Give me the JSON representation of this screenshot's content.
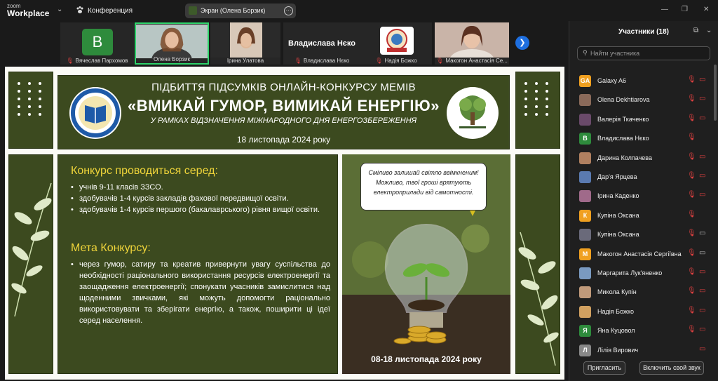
{
  "app": {
    "logo_top": "zoom",
    "logo_bottom": "Workplace",
    "meeting_label": "Конференция"
  },
  "share": {
    "label": "Экран (Олена Борзик)"
  },
  "videos": [
    {
      "name": "Вячеслав Пархомов",
      "initial": "В"
    },
    {
      "name": "Олена Борзик"
    },
    {
      "name": "Ірина Улатова"
    },
    {
      "name": "Владислава Нєко",
      "big_name": "Владислава Нєко"
    },
    {
      "name": "Надія Божко"
    },
    {
      "name": "Макогон Анастасія Се..."
    }
  ],
  "slide": {
    "title_line1": "ПІДБИТТЯ ПІДСУМКІВ ОНЛАЙН-КОНКУРСУ МЕМІВ",
    "title_line2": "«ВМИКАЙ ГУМОР, ВИМИКАЙ ЕНЕРГІЮ»",
    "subtitle": "У РАМКАХ ВІДЗНАЧЕННЯ МІЖНАРОДНОГО ДНЯ ЕНЕРГОЗБЕРЕЖЕННЯ",
    "date": "18 листопада 2024 року",
    "section1_title": "Конкурс проводиться серед:",
    "section1_items": [
      "учнів 9-11 класів ЗЗСО.",
      "здобувачів 1-4 курсів закладів фахової передвищої освіти.",
      "здобувачів 1-4 курсів першого (бакалаврського) рівня вищої освіти."
    ],
    "section2_title": "Мета Конкурсу:",
    "section2_items": [
      "через гумор, сатиру та креатив привернути увагу суспільства до необхідності раціонального використання ресурсів електроенергії та заощадження електроенергії; спонукати учасників замислитися над щоденними звичками, які можуть допомогти раціонально використовувати та зберігати енергію, а також, поширити ці ідеї серед населення."
    ],
    "quote": "Сміливо залишай світло ввімкненим! Можливо, твої гроші врятують електроприлади від самотності.",
    "photo_caption": "08-18 листопада 2024 року"
  },
  "panel": {
    "title": "Участники (18)",
    "search_placeholder": "Найти участника",
    "participants": [
      {
        "name": "Galaxy A6",
        "initial": "GA",
        "color": "#f0a020",
        "cam": "off"
      },
      {
        "name": "Olena Dekhtiarova",
        "initial": "",
        "color": "#8a6a5a",
        "cam": "off"
      },
      {
        "name": "Валерія Ткаченко",
        "initial": "",
        "color": "#6a4a6a",
        "cam": "off"
      },
      {
        "name": "Владислава Нєко",
        "initial": "В",
        "color": "#2e8b3c",
        "cam": "none"
      },
      {
        "name": "Дарина Колпачева",
        "initial": "",
        "color": "#b08060",
        "cam": "off"
      },
      {
        "name": "Дар'я Ярцева",
        "initial": "",
        "color": "#5a7ab0",
        "cam": "off"
      },
      {
        "name": "Ірина Каденко",
        "initial": "",
        "color": "#a06a8a",
        "cam": "off"
      },
      {
        "name": "Купіна Оксана",
        "initial": "К",
        "color": "#f0a020",
        "cam": "none"
      },
      {
        "name": "Купіна Оксана",
        "initial": "",
        "color": "#6a6a7a",
        "cam": "on"
      },
      {
        "name": "Макогон Анастасія Сергіївна",
        "initial": "М",
        "color": "#f0a020",
        "cam": "on"
      },
      {
        "name": "Маргарита Лук'яненко",
        "initial": "",
        "color": "#7a9ac0",
        "cam": "off"
      },
      {
        "name": "Микола Купін",
        "initial": "",
        "color": "#c09a7a",
        "cam": "off"
      },
      {
        "name": "Надія Божко",
        "initial": "",
        "color": "#d0a060",
        "cam": "off"
      },
      {
        "name": "Яна Куцовол",
        "initial": "Я",
        "color": "#2e8b3c",
        "cam": "off"
      },
      {
        "name": "Лілія Вирович",
        "initial": "Л",
        "color": "#888888",
        "cam": "offonly"
      }
    ],
    "invite_label": "Пригласить",
    "unmute_label": "Включить свой звук"
  }
}
